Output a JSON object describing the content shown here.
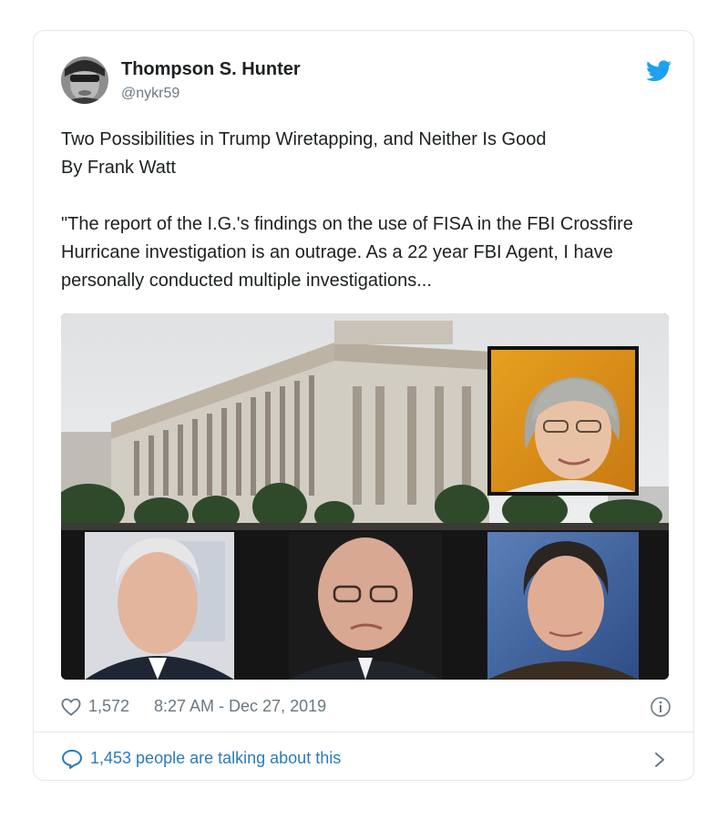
{
  "author": {
    "display_name": "Thompson S. Hunter",
    "handle": "@nykr59"
  },
  "tweet": {
    "line1": "Two Possibilities in Trump Wiretapping, and Neither Is Good",
    "line2": "By Frank Watt",
    "quote": "\"The report of the I.G.'s findings on the use of FISA in the FBI Crossfire Hurricane investigation is an outrage. As a 22 year FBI Agent, I have personally conducted multiple investigations..."
  },
  "meta": {
    "likes": "1,572",
    "timestamp": "8:27 AM - Dec 27, 2019"
  },
  "footer": {
    "talking": "1,453 people are talking about this"
  },
  "icons": {
    "brand": "twitter-bird-icon",
    "like": "heart-icon",
    "info": "info-icon",
    "reply": "speech-bubble-icon",
    "more": "chevron-right-icon"
  },
  "colors": {
    "brand_blue": "#1da1f2",
    "link_blue": "#2b7bb9",
    "muted": "#697882",
    "text": "#1c2022",
    "border": "#e1e8ed"
  }
}
